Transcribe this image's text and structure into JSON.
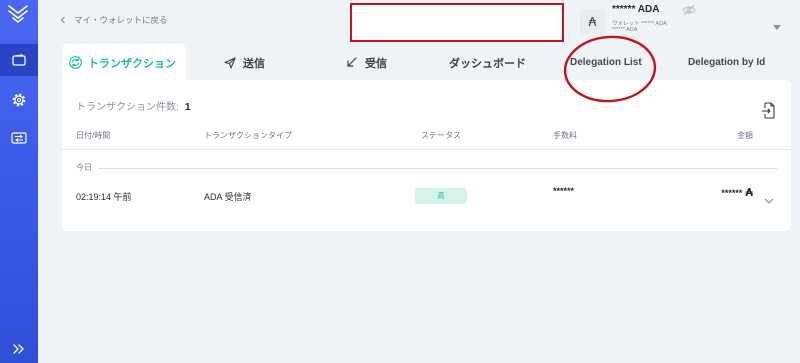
{
  "sidebar": {
    "logo_icon": "yoroi-logo-icon",
    "items": [
      {
        "icon": "wallet-icon",
        "active": true
      },
      {
        "icon": "gear-icon",
        "active": false
      },
      {
        "icon": "transfer-icon",
        "active": false
      }
    ],
    "expand_icon": "double-chevron-right-icon"
  },
  "header": {
    "back_icon": "chevron-left-icon",
    "back_label": "マイ・ウォレットに戻る",
    "wallet": {
      "currency_symbol": "₳",
      "balance": "****** ADA",
      "wallet_balance_line": "ウォレット ****** ADA",
      "rewards_line": "****** ADA",
      "visibility_icon": "eye-off-icon",
      "dropdown_icon": "caret-down-icon"
    }
  },
  "tabs": [
    {
      "label": "トランザクション",
      "icon": "transactions-icon",
      "active": true
    },
    {
      "label": "送信",
      "icon": "send-icon",
      "active": false
    },
    {
      "label": "受信",
      "icon": "receive-icon",
      "active": false
    },
    {
      "label": "ダッシュボード",
      "active": false
    },
    {
      "label": "Delegation List",
      "active": false
    },
    {
      "label": "Delegation by Id",
      "active": false
    }
  ],
  "transactions": {
    "count_label": "トランザクション件数:",
    "count": "1",
    "export_icon": "export-icon",
    "columns": [
      "日付/時間",
      "トランザクションタイプ",
      "ステータス",
      "手数料",
      "金額"
    ],
    "groups": [
      {
        "label": "今日",
        "rows": [
          {
            "time": "02:19:14 午前",
            "type": "ADA 受信済",
            "status": "高",
            "fee": "******",
            "amount": "******",
            "currency_symbol": "₳",
            "expand_icon": "chevron-down-icon"
          }
        ]
      }
    ]
  },
  "colors": {
    "sidebar": "#3b5ce8",
    "sidebar_active": "#2a44c6",
    "accent": "#17bf9e",
    "status_badge_bg": "#d4f3ea",
    "annotation_red": "#c2141b",
    "page_background": "#f0f3f5"
  }
}
